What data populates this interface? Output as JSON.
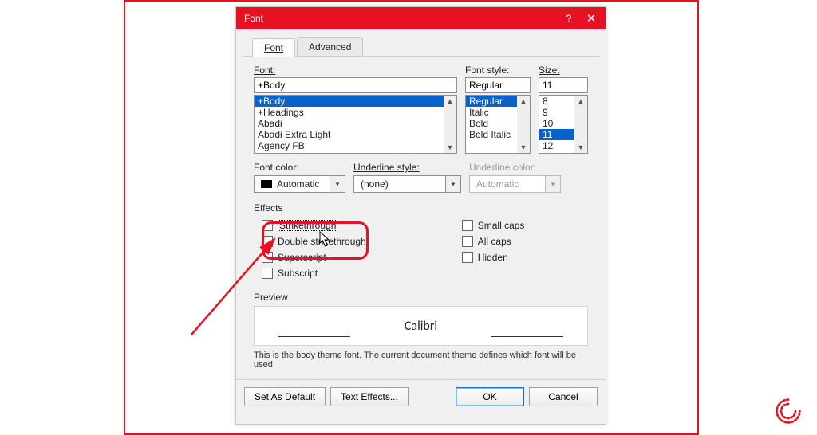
{
  "title": "Font",
  "tabs": {
    "font": "Font",
    "advanced": "Advanced"
  },
  "labels": {
    "font": "Font:",
    "style": "Font style:",
    "size": "Size:",
    "fontcolor": "Font color:",
    "ustyle": "Underline style:",
    "ucolor": "Underline color:",
    "effects": "Effects",
    "preview": "Preview"
  },
  "values": {
    "font": "+Body",
    "style": "Regular",
    "size": "11",
    "color": "Automatic",
    "ustyle": "(none)",
    "ucolor": "Automatic"
  },
  "font_list": [
    "+Body",
    "+Headings",
    "Abadi",
    "Abadi Extra Light",
    "Agency FB"
  ],
  "style_list": [
    "Regular",
    "Italic",
    "Bold",
    "Bold Italic"
  ],
  "size_list": [
    "8",
    "9",
    "10",
    "11",
    "12"
  ],
  "font_selected": "+Body",
  "style_selected": "Regular",
  "size_selected": "11",
  "effects": {
    "strike": "Strikethrough",
    "dstrike": "Double strikethrough",
    "super": "Superscript",
    "sub": "Subscript",
    "small": "Small caps",
    "all": "All caps",
    "hidden": "Hidden"
  },
  "preview_sample": "Calibri",
  "preview_note": "This is the body theme font. The current document theme defines which font will be used.",
  "buttons": {
    "setdefault": "Set As Default",
    "texteffects": "Text Effects...",
    "ok": "OK",
    "cancel": "Cancel"
  },
  "glyphs": {
    "help": "?",
    "close": "✕",
    "up": "▲",
    "down": "▼",
    "dd": "▾"
  }
}
